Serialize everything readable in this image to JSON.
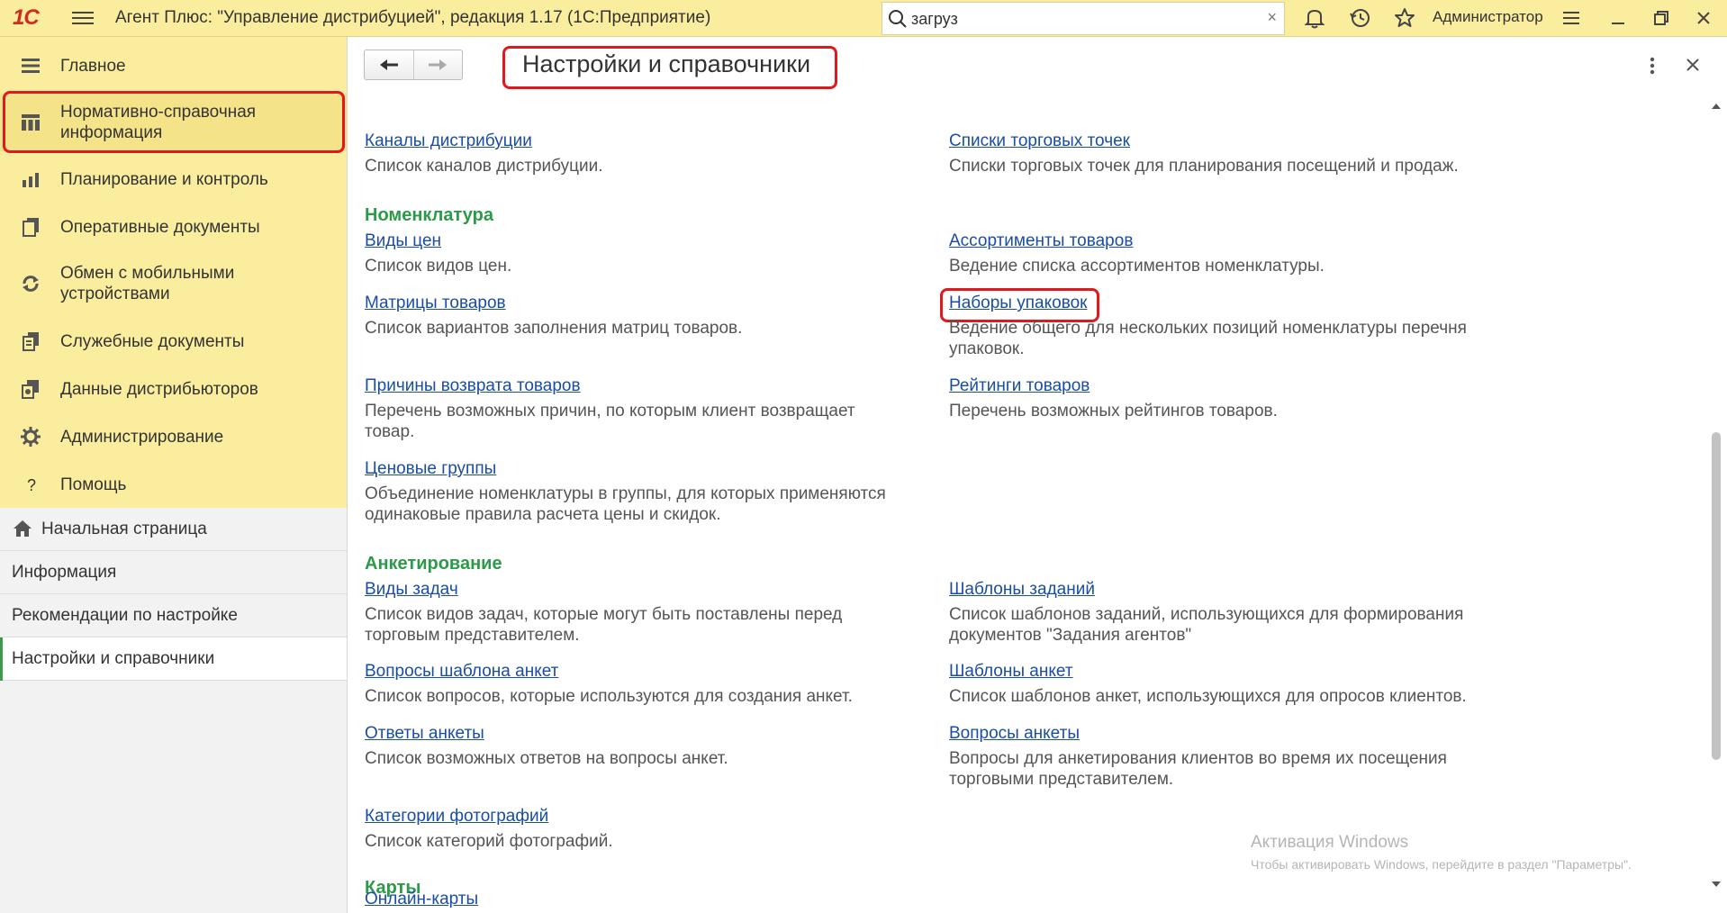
{
  "topbar": {
    "logo": "1С",
    "title": "Агент Плюс: \"Управление дистрибуцией\", редакция 1.17  (1С:Предприятие)",
    "search_value": "загруз",
    "clear_glyph": "×",
    "user": "Администратор"
  },
  "sections": [
    {
      "label": "Главное",
      "icon": "menu-lines-icon"
    },
    {
      "label": "Нормативно-справочная информация",
      "icon": "columns-icon"
    },
    {
      "label": "Планирование и контроль",
      "icon": "bar-chart-icon"
    },
    {
      "label": "Оперативные документы",
      "icon": "documents-icon"
    },
    {
      "label": "Обмен с мобильными устройствами",
      "icon": "sync-icon"
    },
    {
      "label": "Служебные документы",
      "icon": "service-docs-icon"
    },
    {
      "label": "Данные дистрибьюторов",
      "icon": "distributor-data-icon"
    },
    {
      "label": "Администрирование",
      "icon": "gear-icon"
    },
    {
      "label": "Помощь",
      "icon": "question-icon"
    }
  ],
  "nav": [
    {
      "label": "Начальная страница"
    },
    {
      "label": "Информация"
    },
    {
      "label": "Рекомендации по настройке"
    },
    {
      "label": "Настройки и справочники"
    }
  ],
  "page": {
    "title": "Настройки и справочники"
  },
  "items": {
    "channels": {
      "link": "Каналы дистрибуции",
      "desc": "Список каналов дистрибуции."
    },
    "outlets": {
      "link": "Списки торговых точек",
      "desc": "Списки торговых точек для планирования посещений и продаж."
    },
    "price_types": {
      "link": "Виды цен",
      "desc": "Список видов цен."
    },
    "assortments": {
      "link": "Ассортименты товаров",
      "desc": "Ведение списка ассортиментов номенклатуры."
    },
    "matrices": {
      "link": "Матрицы товаров",
      "desc": "Список вариантов заполнения матриц товаров."
    },
    "packages": {
      "link": "Наборы упаковок",
      "desc": "Ведение общего для нескольких позиций номенклатуры перечня упаковок."
    },
    "return_reasons": {
      "link": "Причины возврата товаров",
      "desc": "Перечень возможных причин, по которым клиент возвращает товар."
    },
    "ratings": {
      "link": "Рейтинги товаров",
      "desc": "Перечень возможных рейтингов товаров."
    },
    "price_groups": {
      "link": "Ценовые группы",
      "desc": "Объединение номенклатуры в группы, для которых применяются одинаковые правила расчета цены и скидок."
    },
    "task_types": {
      "link": "Виды задач",
      "desc": "Список видов задач, которые могут быть поставлены перед торговым представителем."
    },
    "task_templates": {
      "link": "Шаблоны заданий",
      "desc": "Список шаблонов заданий, использующихся для формирования документов \"Задания агентов\""
    },
    "template_questions": {
      "link": "Вопросы шаблона анкет",
      "desc": "Список вопросов, которые используются для создания анкет."
    },
    "survey_templates": {
      "link": "Шаблоны анкет",
      "desc": "Список шаблонов анкет, использующихся для опросов клиентов."
    },
    "survey_answers": {
      "link": "Ответы анкеты",
      "desc": "Список возможных ответов на вопросы анкет."
    },
    "survey_questions": {
      "link": "Вопросы анкеты",
      "desc": "Вопросы для анкетирования клиентов во время их посещения торговыми представителем."
    },
    "photo_categories": {
      "link": "Категории фотографий",
      "desc": "Список категорий фотографий."
    },
    "online_maps": {
      "link": "Онлайн-карты"
    }
  },
  "groups": {
    "nomenclature": "Номенклатура",
    "surveys": "Анкетирование",
    "maps": "Карты"
  },
  "watermark": {
    "line1": "Активация Windows",
    "line2": "Чтобы активировать Windows, перейдите в раздел \"Параметры\"."
  },
  "colors": {
    "topbar_bg": "#fbed9e",
    "link": "#1a4da4",
    "group_heading": "#2b9a49",
    "highlight": "#e0191e",
    "active_marker": "#3c9a4a"
  }
}
